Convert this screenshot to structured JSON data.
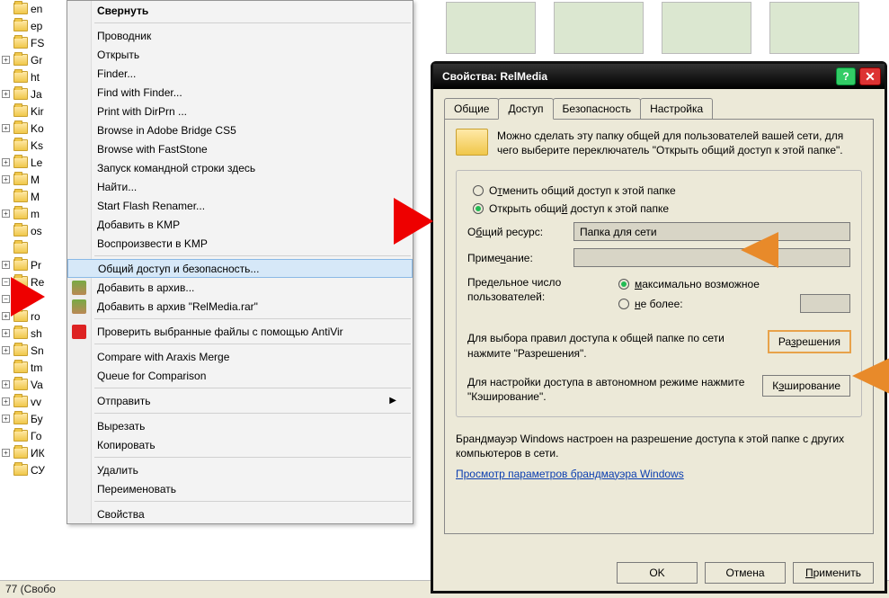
{
  "tree": {
    "items": [
      {
        "exp": "",
        "label": "en"
      },
      {
        "exp": "",
        "label": "ep"
      },
      {
        "exp": "",
        "label": "FS"
      },
      {
        "exp": "+",
        "label": "Gr"
      },
      {
        "exp": "",
        "label": "ht"
      },
      {
        "exp": "+",
        "label": "Ja"
      },
      {
        "exp": "",
        "label": "Kir"
      },
      {
        "exp": "+",
        "label": "Ko"
      },
      {
        "exp": "",
        "label": "Ks"
      },
      {
        "exp": "+",
        "label": "Le"
      },
      {
        "exp": "+",
        "label": "M"
      },
      {
        "exp": "",
        "label": "M"
      },
      {
        "exp": "+",
        "label": "m"
      },
      {
        "exp": "",
        "label": "os"
      },
      {
        "exp": "",
        "label": ""
      },
      {
        "exp": "+",
        "label": "Pr"
      },
      {
        "exp": "−",
        "label": "Re"
      },
      {
        "exp": "−",
        "label": ""
      },
      {
        "exp": "+",
        "label": "ro"
      },
      {
        "exp": "+",
        "label": "sh"
      },
      {
        "exp": "+",
        "label": "Sn"
      },
      {
        "exp": "",
        "label": "tm"
      },
      {
        "exp": "+",
        "label": "Va"
      },
      {
        "exp": "+",
        "label": "vv"
      },
      {
        "exp": "+",
        "label": "Бу"
      },
      {
        "exp": "",
        "label": "Го"
      },
      {
        "exp": "+",
        "label": "ИК"
      },
      {
        "exp": "",
        "label": "СУ"
      }
    ]
  },
  "status_bar": "77 (Свобо",
  "context_menu": {
    "collapse": "Свернуть",
    "explorer": "Проводник",
    "open": "Открыть",
    "finder": "Finder...",
    "find_with_finder": "Find with Finder...",
    "print_dirprn": "Print with DirPrn ...",
    "browse_bridge": "Browse in Adobe Bridge CS5",
    "browse_faststone": "Browse with FastStone",
    "cmd_here": "Запуск командной строки здесь",
    "find": "Найти...",
    "start_flash": "Start Flash Renamer...",
    "add_kmp": "Добавить в KMP",
    "play_kmp": "Воспроизвести в KMP",
    "sharing_security": "Общий доступ и безопасность...",
    "add_archive": "Добавить в архив...",
    "add_archive_rar": "Добавить в архив \"RelMedia.rar\"",
    "antivir": "Проверить выбранные файлы с помощью AntiVir",
    "compare_araxis": "Compare with Araxis Merge",
    "queue_compare": "Queue for Comparison",
    "send_to": "Отправить",
    "cut": "Вырезать",
    "copy": "Копировать",
    "delete": "Удалить",
    "rename": "Переименовать",
    "properties": "Свойства"
  },
  "dialog": {
    "title": "Свойства: RelMedia",
    "tabs": {
      "general": "Общие",
      "sharing": "Доступ",
      "security": "Безопасность",
      "customize": "Настройка"
    },
    "desc": "Можно сделать эту папку общей для пользователей вашей сети, для чего выберите переключатель \"Открыть общий доступ к этой папке\".",
    "radio_no_share_pre": "О",
    "radio_no_share_u": "т",
    "radio_no_share_post": "менить общий доступ к этой папке",
    "radio_share_pre": "Открыть общи",
    "radio_share_u": "й",
    "radio_share_post": " доступ к этой папке",
    "share_name_label_pre": "О",
    "share_name_label_u": "б",
    "share_name_label_post": "щий ресурс:",
    "share_name_value": "Папка для сети",
    "comment_label_pre": "Приме",
    "comment_label_u": "ч",
    "comment_label_post": "ание:",
    "comment_value": "",
    "user_limit_label": "Предельное число пользователей:",
    "radio_max_pre": "",
    "radio_max_u": "м",
    "radio_max_post": "аксимально возможное",
    "radio_atmost_pre": "",
    "radio_atmost_u": "н",
    "radio_atmost_post": "е более:",
    "perm_text": "Для выбора правил доступа к общей папке по сети нажмите \"Разрешения\".",
    "perm_btn_pre": "Ра",
    "perm_btn_u": "з",
    "perm_btn_post": "решения",
    "cache_text": "Для настройки доступа в автономном режиме нажмите \"Кэширование\".",
    "cache_btn_pre": "К",
    "cache_btn_u": "э",
    "cache_btn_post": "ширование",
    "firewall_text": "Брандмауэр Windows настроен на разрешение доступа к этой папке с других компьютеров в сети.",
    "firewall_link": "Просмотр параметров брандмауэра Windows",
    "ok": "OK",
    "cancel": "Отмена",
    "apply_pre": "",
    "apply_u": "П",
    "apply_post": "рименить"
  }
}
